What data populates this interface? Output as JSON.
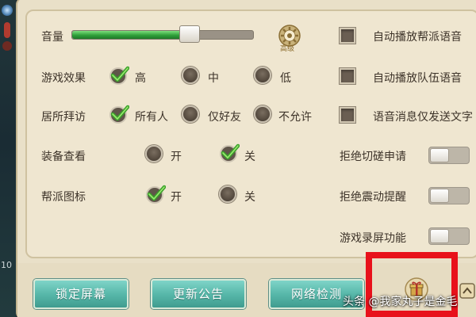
{
  "left_strip": {
    "number": "10"
  },
  "settings": {
    "volume": {
      "label": "音量",
      "level": 0.62,
      "advanced_text": "高级"
    },
    "effects": {
      "label": "游戏效果",
      "options": [
        "高",
        "中",
        "低"
      ],
      "selected": "高"
    },
    "visit": {
      "label": "居所拜访",
      "options": [
        "所有人",
        "仅好友",
        "不允许"
      ],
      "selected": "所有人"
    },
    "equip": {
      "label": "装备查看",
      "options": [
        "开",
        "关"
      ],
      "selected": "关"
    },
    "guild_icon": {
      "label": "帮派图标",
      "options": [
        "开",
        "关"
      ],
      "selected": "开"
    }
  },
  "right_options": {
    "checkboxes": [
      {
        "label": "自动播放帮派语音",
        "checked": false
      },
      {
        "label": "自动播放队伍语音",
        "checked": false
      },
      {
        "label": "语音消息仅发送文字",
        "checked": false
      }
    ],
    "toggles": [
      {
        "label": "拒绝切磋申请",
        "on": false
      },
      {
        "label": "拒绝震动提醒",
        "on": false
      },
      {
        "label": "游戏录屏功能",
        "on": false
      }
    ]
  },
  "buttons": {
    "lock_screen": "锁定屏幕",
    "update_notice": "更新公告",
    "network_check": "网络检测"
  },
  "watermark": "头条 @我家丸子是金毛",
  "icons": {
    "gear": "gear-icon",
    "check": "check-icon",
    "gift": "gift-icon"
  },
  "colors": {
    "panel": "#efe6d0",
    "button": "#58b8aa",
    "check": "#3aa02a",
    "highlight": "#e8111b"
  }
}
